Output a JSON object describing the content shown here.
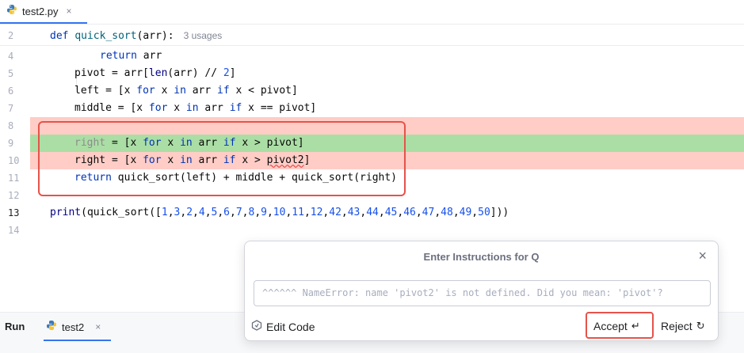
{
  "tab": {
    "filename": "test2.py",
    "close": "×"
  },
  "editor": {
    "lines": [
      {
        "num": "2",
        "text_parts": [
          "def",
          " ",
          "quick_sort",
          "(arr):"
        ],
        "hint": "3 usages"
      },
      {
        "num": "4",
        "code": "return arr"
      },
      {
        "num": "5",
        "code": "pivot = arr[len(arr) // 2]"
      },
      {
        "num": "6",
        "code": "left = [x for x in arr if x < pivot]"
      },
      {
        "num": "7",
        "code": "middle = [x for x in arr if x == pivot]"
      },
      {
        "num": "8",
        "code": ""
      },
      {
        "num": "9",
        "code": "right = [x for x in arr if x > pivot]"
      },
      {
        "num": "10",
        "code": "right = [x for x in arr if x > pivot2]"
      },
      {
        "num": "11",
        "code": "return quick_sort(left) + middle + quick_sort(right)"
      },
      {
        "num": "12",
        "code": ""
      },
      {
        "num": "13",
        "code": "print(quick_sort([1,3,2,4,5,6,7,8,9,10,11,12,42,43,44,45,46,47,48,49,50]))"
      },
      {
        "num": "14",
        "code": ""
      }
    ]
  },
  "colors": {
    "removed_bg": "#ffcdc6",
    "added_bg": "#abdea5",
    "highlight_border": "#e5534b",
    "accent": "#3574f0"
  },
  "run": {
    "label": "Run",
    "config": "test2",
    "close": "×"
  },
  "popup": {
    "title": "Enter Instructions for Q",
    "close": "×",
    "placeholder": "^^^^^^ NameError: name 'pivot2' is not defined. Did you mean: 'pivot'?",
    "edit_code": "Edit Code",
    "accept": "Accept",
    "accept_symbol": "↵",
    "reject": "Reject",
    "reject_symbol": "↻"
  }
}
